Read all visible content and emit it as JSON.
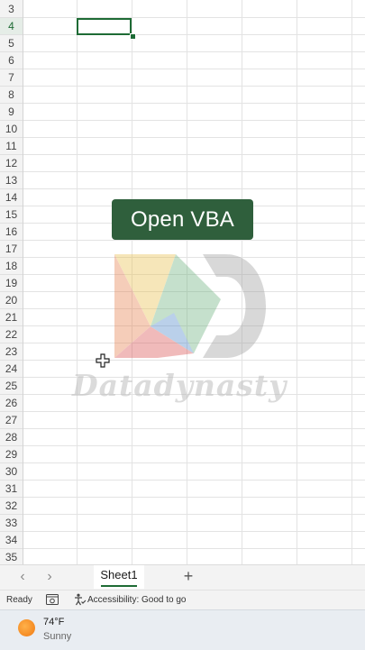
{
  "grid": {
    "row_numbers": [
      "3",
      "4",
      "5",
      "6",
      "7",
      "8",
      "9",
      "10",
      "11",
      "12",
      "13",
      "14",
      "15",
      "16",
      "17",
      "18",
      "19",
      "20",
      "21",
      "22",
      "23",
      "24",
      "25",
      "26",
      "27",
      "28",
      "29",
      "30",
      "31",
      "32",
      "33",
      "34",
      "35"
    ],
    "active_row": "4"
  },
  "caption": {
    "text": "Open VBA"
  },
  "watermark": {
    "text": "Datadynasty"
  },
  "sheet_tabs": {
    "prev_label": "‹",
    "next_label": "›",
    "active_sheet": "Sheet1",
    "add_label": "+"
  },
  "status_bar": {
    "ready": "Ready",
    "accessibility": "Accessibility: Good to go"
  },
  "taskbar": {
    "temperature": "74°F",
    "condition": "Sunny"
  },
  "colors": {
    "accent": "#1e6b35",
    "caption_bg": "#2f5f3c",
    "weather_sun": "#f08a1c"
  }
}
